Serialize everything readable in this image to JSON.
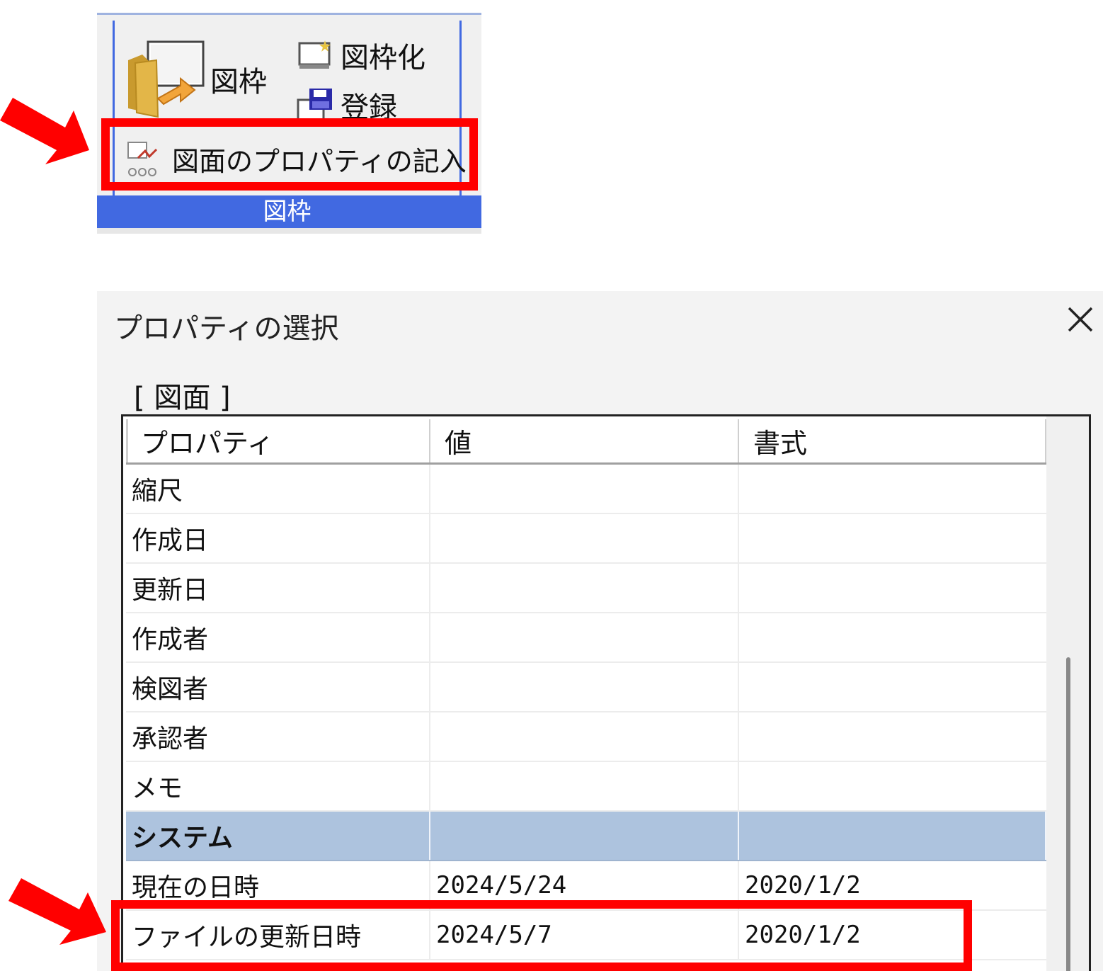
{
  "ribbon": {
    "frame_button_label": "図枠",
    "convert_button_label": "図枠化",
    "register_button_label": "登録",
    "properties_button_label": "図面のプロパティの記入",
    "group_label": "図枠"
  },
  "dialog": {
    "title": "プロパティの選択",
    "section_label": "[ 図面 ]",
    "columns": [
      "プロパティ",
      "値",
      "書式"
    ],
    "rows": [
      {
        "property": "縮尺",
        "value": "",
        "format": ""
      },
      {
        "property": "作成日",
        "value": "",
        "format": ""
      },
      {
        "property": "更新日",
        "value": "",
        "format": ""
      },
      {
        "property": "作成者",
        "value": "",
        "format": ""
      },
      {
        "property": "検図者",
        "value": "",
        "format": ""
      },
      {
        "property": "承認者",
        "value": "",
        "format": ""
      },
      {
        "property": "メモ",
        "value": "",
        "format": ""
      }
    ],
    "group": {
      "label": "システム"
    },
    "system_rows": [
      {
        "property": "現在の日時",
        "value": "2024/5/24",
        "format": "2020/1/2"
      },
      {
        "property": "ファイルの更新日時",
        "value": "2024/5/7",
        "format": "2020/1/2"
      }
    ]
  },
  "colors": {
    "highlight": "#ff0000",
    "ribbon_accent": "#4169e1",
    "group_row": "#adc3de"
  },
  "icons": {
    "frame": "folder-frame-icon",
    "convert": "frame-convert-icon",
    "register": "save-disk-icon",
    "properties": "properties-icon",
    "close": "close-icon",
    "arrow": "red-arrow-icon"
  }
}
